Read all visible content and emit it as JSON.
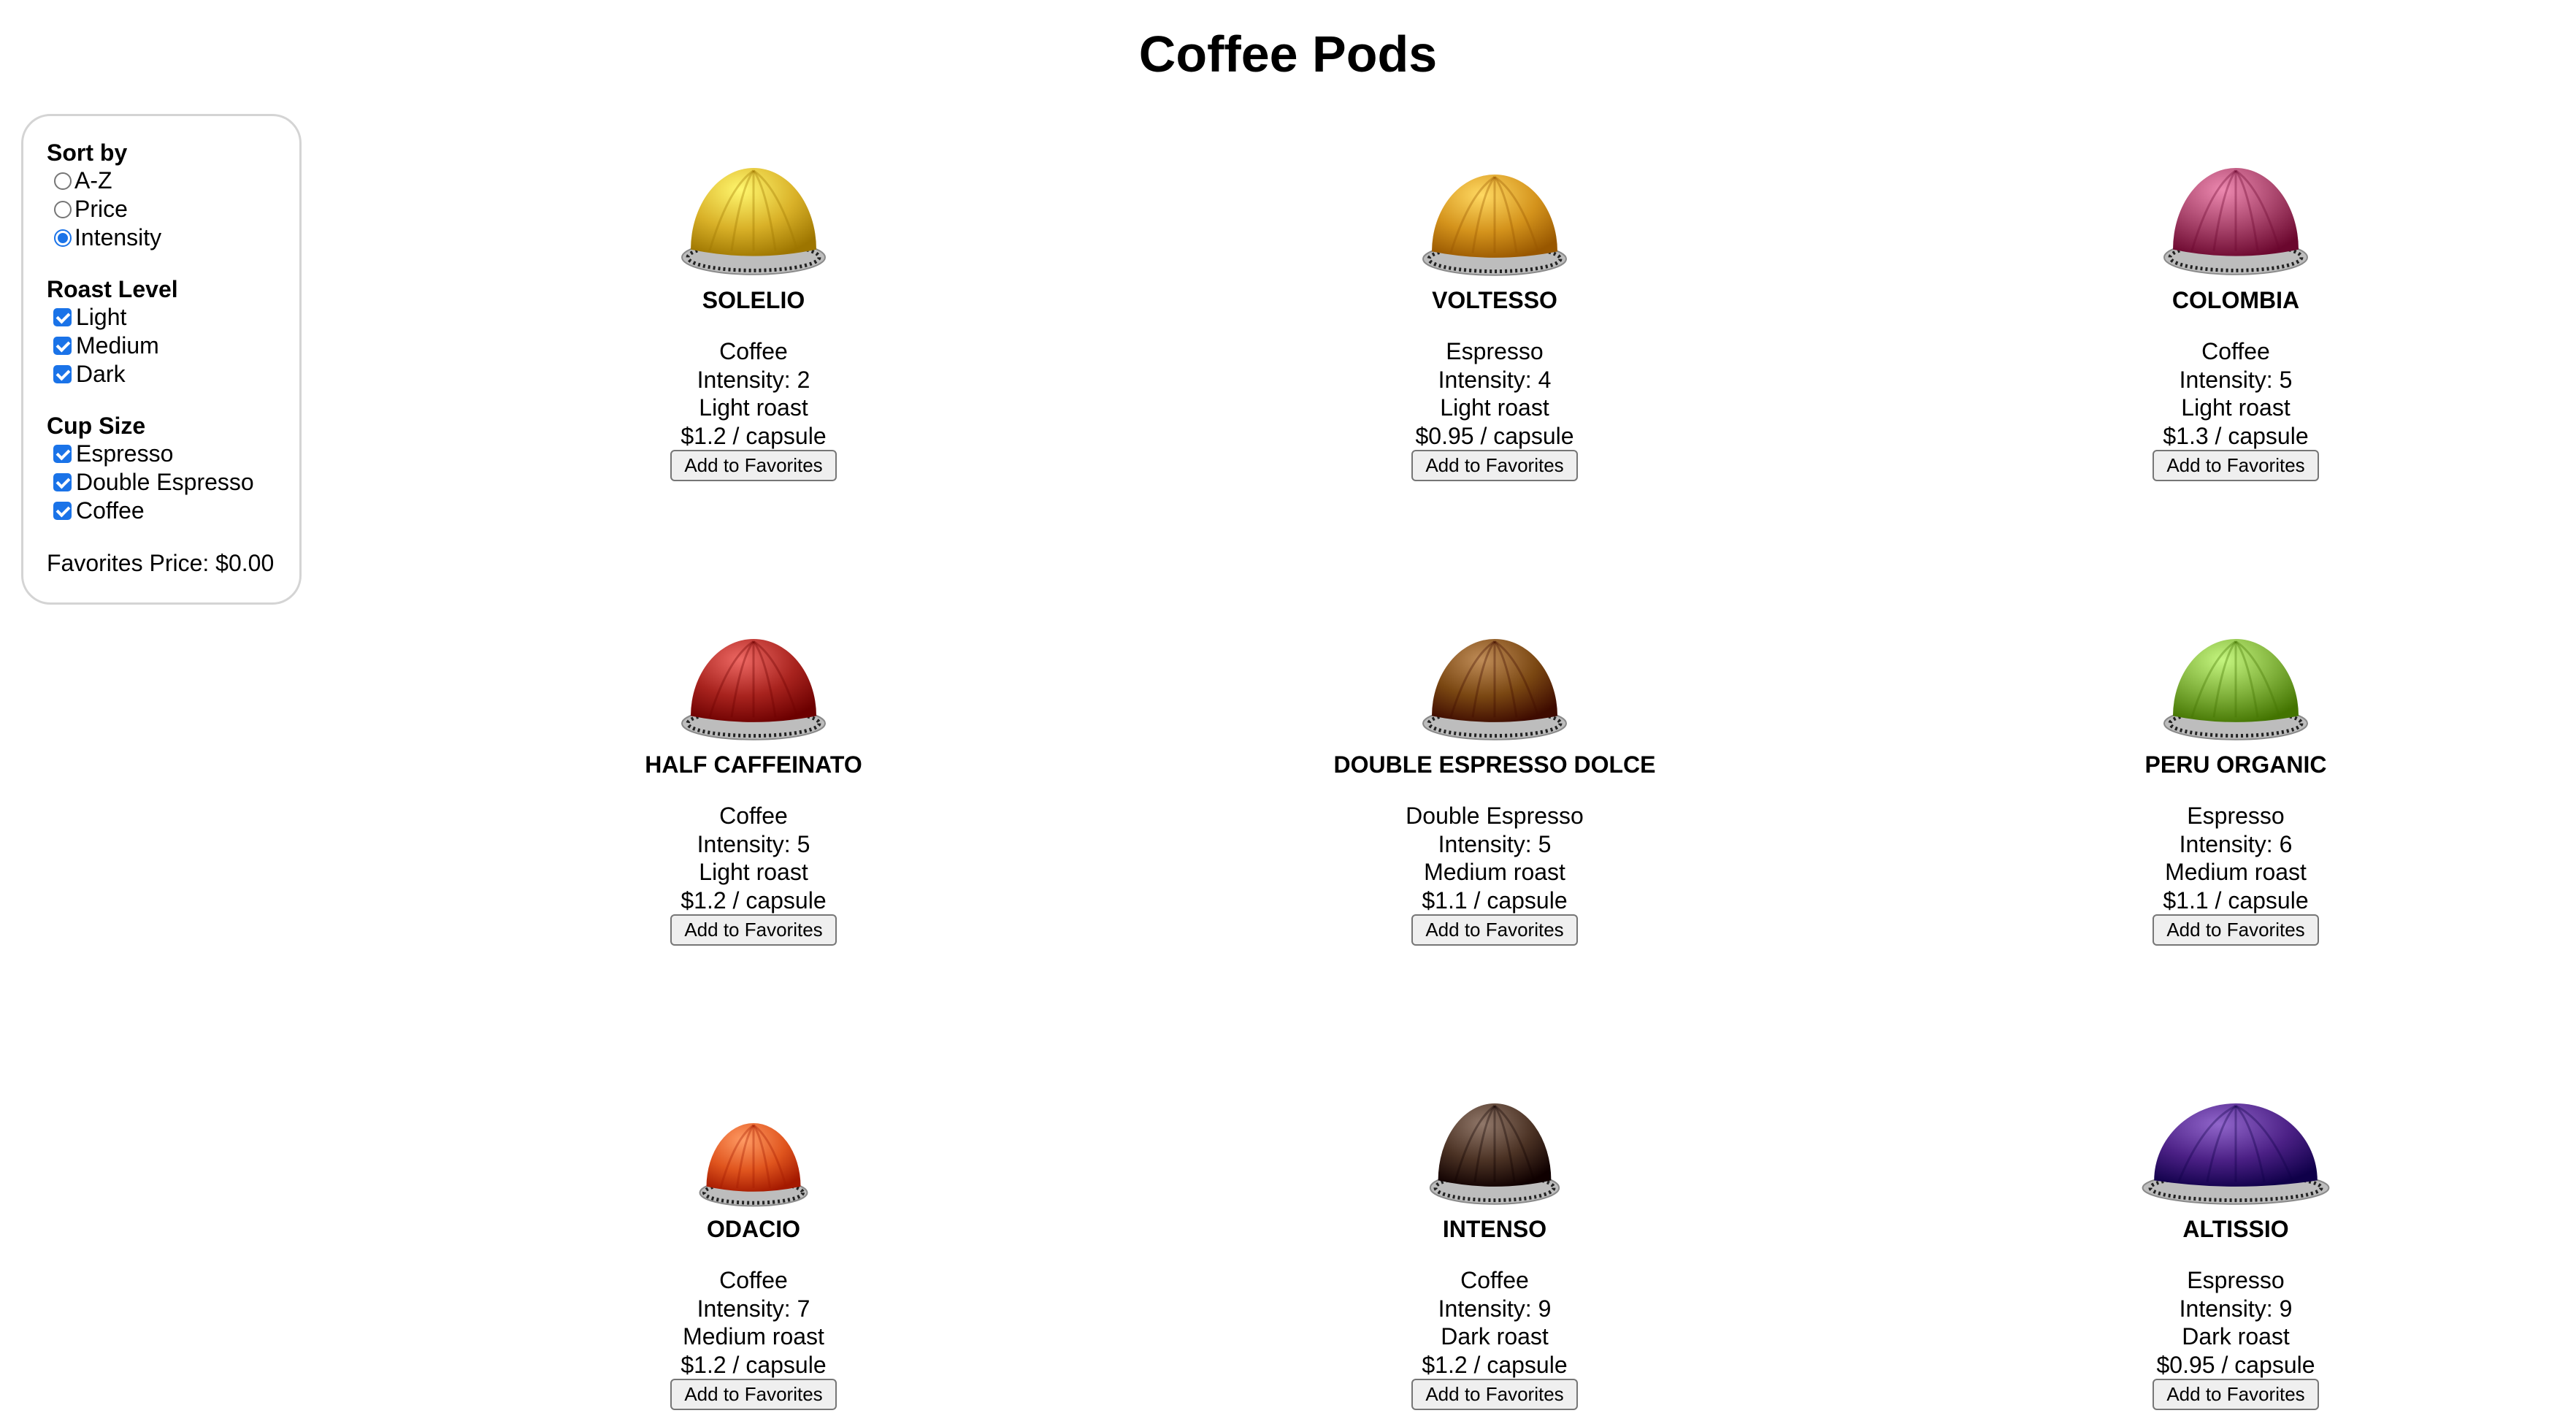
{
  "title": "Coffee Pods",
  "sidebar": {
    "sort": {
      "title": "Sort by",
      "options": [
        {
          "label": "A-Z",
          "checked": false
        },
        {
          "label": "Price",
          "checked": false
        },
        {
          "label": "Intensity",
          "checked": true
        }
      ]
    },
    "roast": {
      "title": "Roast Level",
      "options": [
        {
          "label": "Light",
          "checked": true
        },
        {
          "label": "Medium",
          "checked": true
        },
        {
          "label": "Dark",
          "checked": true
        }
      ]
    },
    "cup": {
      "title": "Cup Size",
      "options": [
        {
          "label": "Espresso",
          "checked": true
        },
        {
          "label": "Double Espresso",
          "checked": true
        },
        {
          "label": "Coffee",
          "checked": true
        }
      ]
    },
    "favorites_price": "Favorites Price: $0.00"
  },
  "button_label": "Add to Favorites",
  "pods": [
    {
      "name": "SOLELIO",
      "cup": "Coffee",
      "intensity": "Intensity: 2",
      "roast": "Light roast",
      "price": "$1.2 / capsule",
      "color": "#d9b128",
      "icon": "solelio-capsule-icon"
    },
    {
      "name": "VOLTESSO",
      "cup": "Espresso",
      "intensity": "Intensity: 4",
      "roast": "Light roast",
      "price": "$0.95 / capsule",
      "color": "#d4931c",
      "icon": "voltesso-capsule-icon"
    },
    {
      "name": "COLOMBIA",
      "cup": "Coffee",
      "intensity": "Intensity: 5",
      "roast": "Light roast",
      "price": "$1.3 / capsule",
      "color": "#a7436a",
      "icon": "colombia-capsule-icon"
    },
    {
      "name": "HALF CAFFEINATO",
      "cup": "Coffee",
      "intensity": "Intensity: 5",
      "roast": "Light roast",
      "price": "$1.2 / capsule",
      "color": "#a8231e",
      "icon": "half-caffeinato-capsule-icon"
    },
    {
      "name": "DOUBLE ESPRESSO DOLCE",
      "cup": "Double Espresso",
      "intensity": "Intensity: 5",
      "roast": "Medium roast",
      "price": "$1.1 / capsule",
      "color": "#7a4712",
      "icon": "double-espresso-dolce-capsule-icon"
    },
    {
      "name": "PERU ORGANIC",
      "cup": "Espresso",
      "intensity": "Intensity: 6",
      "roast": "Medium roast",
      "price": "$1.1 / capsule",
      "color": "#7fb03a",
      "icon": "peru-organic-capsule-icon"
    },
    {
      "name": "ODACIO",
      "cup": "Coffee",
      "intensity": "Intensity: 7",
      "roast": "Medium roast",
      "price": "$1.2 / capsule",
      "color": "#e0551e",
      "icon": "odacio-capsule-icon"
    },
    {
      "name": "INTENSO",
      "cup": "Coffee",
      "intensity": "Intensity: 9",
      "roast": "Dark roast",
      "price": "$1.2 / capsule",
      "color": "#4b3224",
      "icon": "intenso-capsule-icon"
    },
    {
      "name": "ALTISSIO",
      "cup": "Espresso",
      "intensity": "Intensity: 9",
      "roast": "Dark roast",
      "price": "$0.95 / capsule",
      "color": "#4b2085",
      "icon": "altissio-capsule-icon"
    }
  ]
}
